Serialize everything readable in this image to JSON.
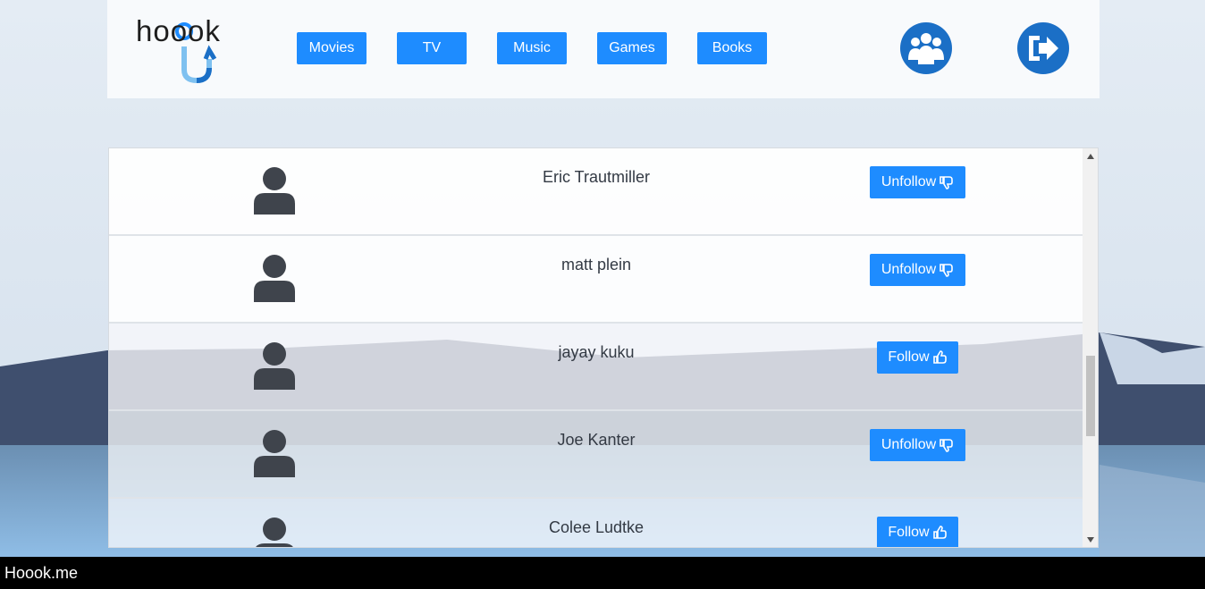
{
  "brand": {
    "logo_text": "hoook",
    "footer_text": "Hoook.me"
  },
  "colors": {
    "accent": "#1e8cff",
    "circle_button": "#1b6fc6",
    "avatar": "#3f444c"
  },
  "nav": {
    "items": [
      {
        "label": "Movies"
      },
      {
        "label": "TV"
      },
      {
        "label": "Music"
      },
      {
        "label": "Games"
      },
      {
        "label": "Books"
      }
    ],
    "friends_icon": "group-users-icon",
    "logout_icon": "sign-out-icon"
  },
  "users": [
    {
      "name": "Eric Trautmiller",
      "action": "Unfollow",
      "action_icon": "thumbs-down-icon"
    },
    {
      "name": "matt plein",
      "action": "Unfollow",
      "action_icon": "thumbs-down-icon"
    },
    {
      "name": "jayay kuku",
      "action": "Follow",
      "action_icon": "thumbs-up-icon"
    },
    {
      "name": "Joe Kanter",
      "action": "Unfollow",
      "action_icon": "thumbs-down-icon"
    },
    {
      "name": "Colee Ludtke",
      "action": "Follow",
      "action_icon": "thumbs-up-icon"
    }
  ]
}
